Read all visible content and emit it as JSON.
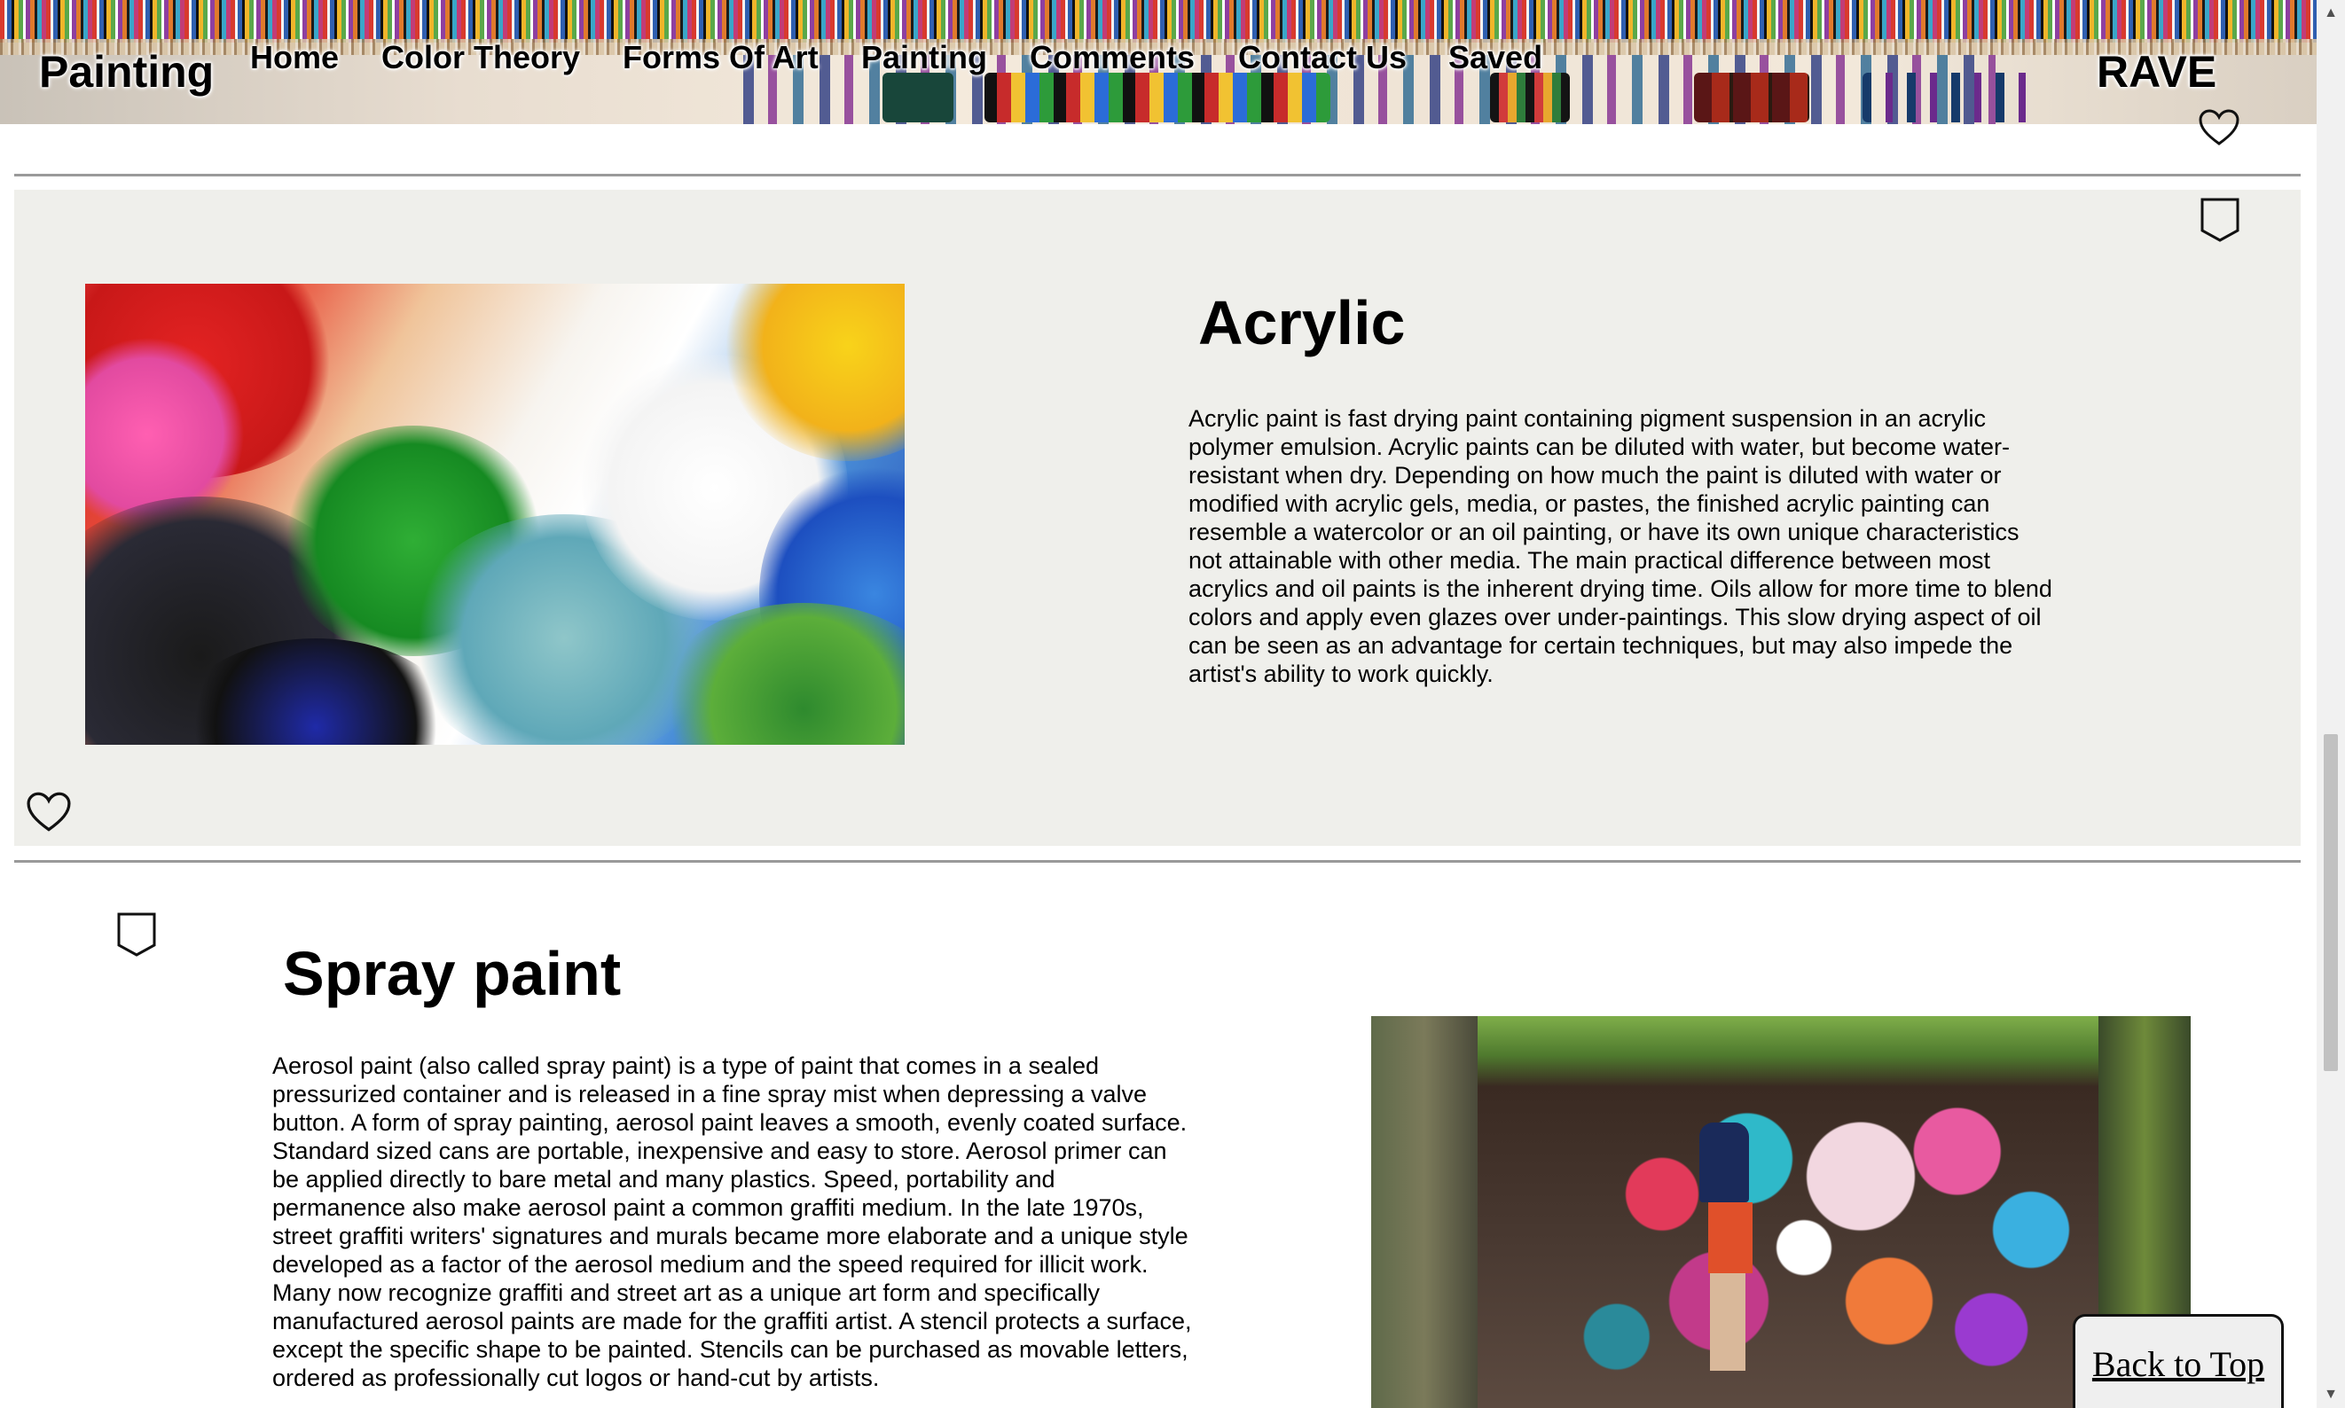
{
  "header": {
    "brand": "Painting",
    "brand_right": "RAVE",
    "nav": [
      {
        "label": "Home"
      },
      {
        "label": "Color Theory"
      },
      {
        "label": "Forms Of Art"
      },
      {
        "label": "Painting"
      },
      {
        "label": "Comments"
      },
      {
        "label": "Contact Us"
      },
      {
        "label": "Saved"
      }
    ]
  },
  "icons": {
    "bookmark": "bookmark-icon",
    "heart": "heart-icon"
  },
  "sections": {
    "acrylic": {
      "title": "Acrylic",
      "text": "Acrylic paint is fast drying paint containing pigment suspension in an acrylic polymer emulsion. Acrylic paints can be diluted with water, but become water-resistant when dry. Depending on how much the paint is diluted with water or modified with acrylic gels, media, or pastes, the finished acrylic painting can resemble a watercolor or an oil painting, or have its own unique characteristics not attainable with other media. The main practical difference between most acrylics and oil paints is the inherent drying time. Oils allow for more time to blend colors and apply even glazes over under-paintings. This slow drying aspect of oil can be seen as an advantage for certain techniques, but may also impede the artist's ability to work quickly."
    },
    "spray": {
      "title": "Spray paint",
      "text": "Aerosol paint (also called spray paint) is a type of paint that comes in a sealed pressurized container and is released in a fine spray mist when depressing a valve button. A form of spray painting, aerosol paint leaves a smooth, evenly coated surface. Standard sized cans are portable, inexpensive and easy to store. Aerosol primer can be applied directly to bare metal and many plastics. Speed, portability and permanence also make aerosol paint a common graffiti medium. In the late 1970s, street graffiti writers' signatures and murals became more elaborate and a unique style developed as a factor of the aerosol medium and the speed required for illicit work. Many now recognize graffiti and street art as a unique art form and specifically manufactured aerosol paints are made for the graffiti artist. A stencil protects a surface, except the specific shape to be painted. Stencils can be purchased as movable letters, ordered as professionally cut logos or hand-cut by artists."
    }
  },
  "back_to_top": "Back to Top",
  "colors": {
    "section_bg": "#efefeb",
    "divider": "#9a9a9a",
    "text": "#000000"
  }
}
